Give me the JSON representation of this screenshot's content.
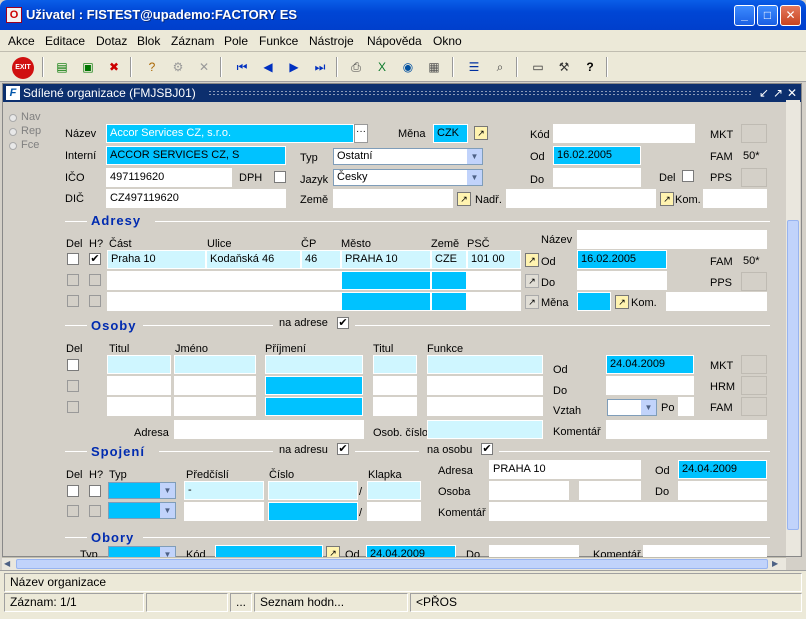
{
  "window": {
    "title": "Uživatel : FISTEST@upademo:FACTORY ES",
    "app_icon": "oracle-forms-icon",
    "buttons": {
      "minimize": "_",
      "maximize": "□",
      "close": "✕"
    }
  },
  "menu": [
    "Akce",
    "Editace",
    "Dotaz",
    "Blok",
    "Záznam",
    "Pole",
    "Funkce",
    "Nástroje",
    "Nápověda",
    "Okno"
  ],
  "toolbar": {
    "exit": "EXIT",
    "icons": [
      "insert-record-icon",
      "save-record-icon",
      "delete-record-icon",
      "enter-query-icon",
      "execute-query-icon",
      "cancel-query-icon",
      "first-record-icon",
      "previous-record-icon",
      "next-record-icon",
      "last-record-icon",
      "print-icon",
      "excel-icon",
      "export-icon",
      "report-icon",
      "list-icon",
      "zoom-icon",
      "edit-icon",
      "tools-icon",
      "help-icon"
    ]
  },
  "panel": {
    "title": "Sdílené organizace (FMJSBJ01)",
    "icon": "forms-icon",
    "nav": [
      "Nav",
      "Rep",
      "Fce"
    ]
  },
  "org": {
    "nazev_lbl": "Název",
    "nazev": "Accor Services CZ, s.r.o.",
    "mena_lbl": "Měna",
    "mena": "CZK",
    "kod_lbl": "Kód",
    "kod": "",
    "mkt_lbl": "MKT",
    "interni_lbl": "Interní",
    "interni": "ACCOR SERVICES CZ, S",
    "typ_lbl": "Typ",
    "typ": "Ostatní",
    "od_lbl": "Od",
    "od": "16.02.2005",
    "fam_lbl": "FAM",
    "fam": "50*",
    "ico_lbl": "IČO",
    "ico": "497119620",
    "dph_lbl": "DPH",
    "jazyk_lbl": "Jazyk",
    "jazyk": "Česky",
    "do_lbl": "Do",
    "del_lbl": "Del",
    "pps_lbl": "PPS",
    "dic_lbl": "DIČ",
    "dic": "CZ497119620",
    "zeme_lbl": "Země",
    "nadr_lbl": "Nadř.",
    "kom_lbl": "Kom."
  },
  "adresy": {
    "title": "Adresy",
    "nazev_lbl": "Název",
    "cols": [
      "Del",
      "H?",
      "Část",
      "Ulice",
      "ČP",
      "Město",
      "Země",
      "PSČ"
    ],
    "rows": [
      {
        "cast": "Praha 10",
        "ulice": "Kodaňská 46",
        "cp": "46",
        "mesto": "PRAHA 10",
        "zeme": "CZE",
        "psc": "101 00",
        "hlavni": "✔"
      }
    ],
    "od_lbl": "Od",
    "od": "16.02.2005",
    "do_lbl": "Do",
    "mena_lbl": "Měna",
    "kom_lbl": "Kom.",
    "fam_lbl": "FAM",
    "fam": "50*",
    "pps_lbl": "PPS"
  },
  "osoby": {
    "title": "Osoby",
    "na_adrese_lbl": "na adrese",
    "na_adrese": "✔",
    "cols": [
      "Del",
      "Titul",
      "Jméno",
      "Příjmení",
      "Titul",
      "Funkce"
    ],
    "od_lbl": "Od",
    "od": "24.04.2009",
    "mkt_lbl": "MKT",
    "do_lbl": "Do",
    "hrm_lbl": "HRM",
    "vztah_lbl": "Vztah",
    "po_lbl": "Po",
    "fam_lbl": "FAM",
    "adresa_lbl": "Adresa",
    "osob_cislo_lbl": "Osob. číslo",
    "komentar_lbl": "Komentář"
  },
  "spojeni": {
    "title": "Spojení",
    "na_adresu_lbl": "na adresu",
    "na_adresu": "✔",
    "na_osobu_lbl": "na osobu",
    "na_osobu": "✔",
    "cols": [
      "Del",
      "H?",
      "Typ",
      "Předčíslí",
      "Číslo",
      "Klapka"
    ],
    "row1_predcisli": "-",
    "slash": "/",
    "adresa_lbl": "Adresa",
    "adresa": "PRAHA 10",
    "od_lbl": "Od",
    "od": "24.04.2009",
    "osoba_lbl": "Osoba",
    "do_lbl": "Do",
    "komentar_lbl": "Komentář"
  },
  "obory": {
    "title": "Obory",
    "typ_lbl": "Typ",
    "kod_lbl": "Kód",
    "od_lbl": "Od",
    "od": "24.04.2009",
    "do_lbl": "Do",
    "komentar_lbl": "Komentář"
  },
  "status": {
    "hint": "Název organizace",
    "zaznam": "Záznam: 1/1",
    "dots": "...",
    "seznam": "Seznam hodn...",
    "pros": "<PŘOS"
  }
}
